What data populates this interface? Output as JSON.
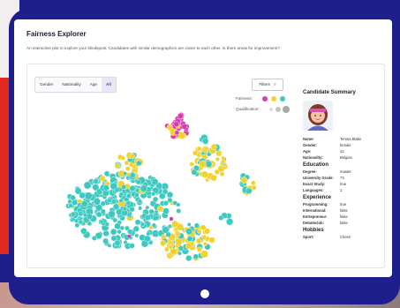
{
  "app": {
    "title": "Fairness Explorer",
    "subtitle": "An interactive plot to explore your blindspots. Candidates with similar demographics are closer to each other. Is there areas for improvement?"
  },
  "tabs": [
    {
      "label": "Gender",
      "active": false
    },
    {
      "label": "Nationality",
      "active": false
    },
    {
      "label": "Age",
      "active": false
    },
    {
      "label": "All",
      "active": true
    }
  ],
  "filters": {
    "label": "Filters"
  },
  "legend": {
    "fairness_label": "Fairness:",
    "qualification_label": "Qualification:",
    "fairness_colors": [
      "#d63bb0",
      "#f2d22e",
      "#3ec9c0"
    ],
    "qualification_colors": [
      "#dcdcdc",
      "#c4c4c4",
      "#a9a9a9"
    ]
  },
  "summary": {
    "title": "Candidate Summary",
    "basic": [
      {
        "key": "Name:",
        "value": "Teresa Blake"
      },
      {
        "key": "Gender:",
        "value": "female"
      },
      {
        "key": "Age:",
        "value": "22"
      },
      {
        "key": "Nationality:",
        "value": "Belgian"
      }
    ],
    "education_title": "Education",
    "education": [
      {
        "key": "Degree:",
        "value": "master"
      },
      {
        "key": "University Grade:",
        "value": "73"
      },
      {
        "key": "Exact Study:",
        "value": "true"
      },
      {
        "key": "Languages:",
        "value": "1"
      }
    ],
    "experience_title": "Experience",
    "experience": [
      {
        "key": "Programming:",
        "value": "true"
      },
      {
        "key": "International:",
        "value": "false"
      },
      {
        "key": "Entrepreneur:",
        "value": "false"
      },
      {
        "key": "Debateclub:",
        "value": "false"
      }
    ],
    "hobbies_title": "Hobbies",
    "hobbies": [
      {
        "key": "Sport:",
        "value": "Chess"
      }
    ]
  },
  "colors": {
    "frame": "#1e1e8c",
    "accent": "#3b46c4",
    "teal": "#3ec9c0",
    "yellow": "#f2d22e",
    "magenta": "#d63bb0"
  }
}
